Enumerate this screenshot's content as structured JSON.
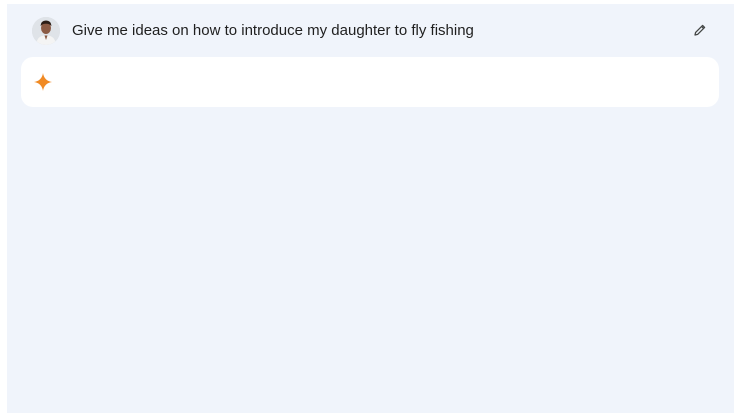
{
  "prompt": {
    "text": "Give me ideas on how to introduce my daughter to fly fishing",
    "avatar_icon": "user-avatar",
    "edit_icon": "pencil-icon"
  },
  "response": {
    "icon": "gemini-spark-icon",
    "accent_color": "#f08a24"
  },
  "colors": {
    "background": "#f0f4fb",
    "card": "#ffffff",
    "text": "#1f1f1f"
  }
}
